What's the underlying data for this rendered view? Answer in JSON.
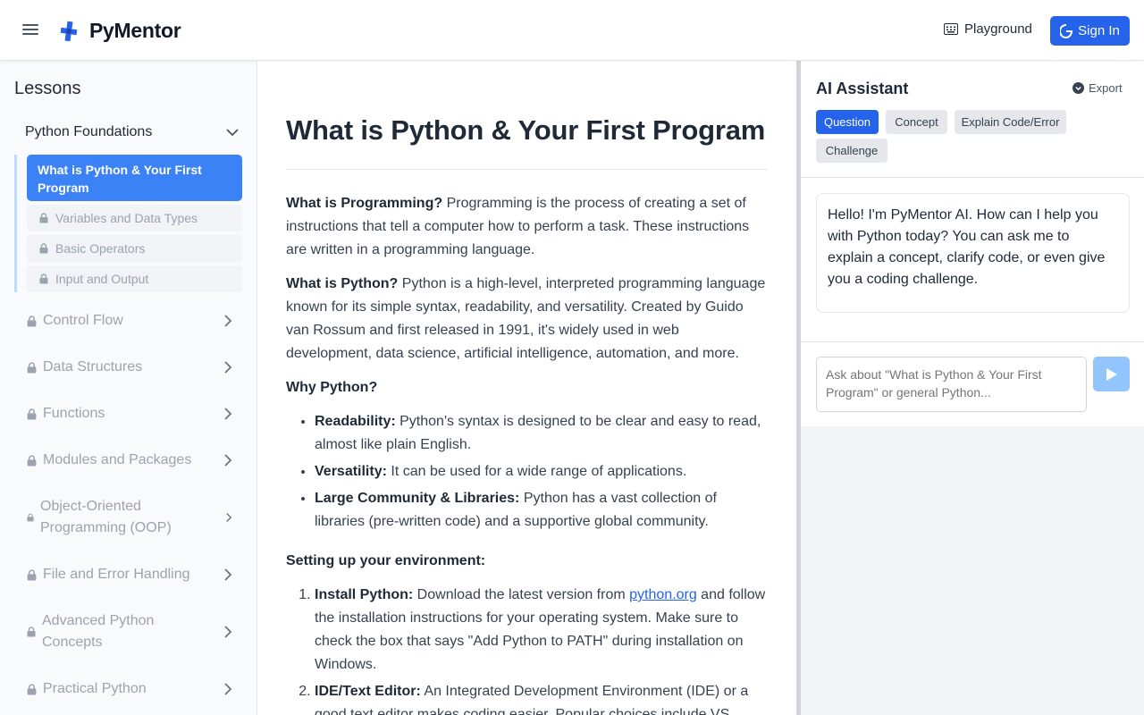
{
  "header": {
    "app_name": "PyMentor",
    "playground_label": "Playground",
    "signin_label": "Sign In"
  },
  "sidebar": {
    "title": "Lessons",
    "open_section": {
      "label": "Python Foundations",
      "items": [
        {
          "label": "What is Python & Your First Program",
          "active": true
        },
        {
          "label": "Variables and Data Types",
          "locked": true
        },
        {
          "label": "Basic Operators",
          "locked": true
        },
        {
          "label": "Input and Output",
          "locked": true
        }
      ]
    },
    "sections": [
      {
        "label": "Control Flow"
      },
      {
        "label": "Data Structures"
      },
      {
        "label": "Functions"
      },
      {
        "label": "Modules and Packages"
      },
      {
        "label": "Object-Oriented Programming (OOP)"
      },
      {
        "label": "File and Error Handling"
      },
      {
        "label": "Advanced Python Concepts"
      },
      {
        "label": "Practical Python"
      }
    ]
  },
  "lesson": {
    "title": "What is Python & Your First Program",
    "p1_bold": "What is Programming?",
    "p1_text": " Programming is the process of creating a set of instructions that tell a computer how to perform a task. These instructions are written in a programming language.",
    "p2_bold": "What is Python?",
    "p2_text": " Python is a high-level, interpreted programming language known for its simple syntax, readability, and versatility. Created by Guido van Rossum and first released in 1991, it's widely used in web development, data science, artificial intelligence, automation, and more.",
    "why_heading": "Why Python?",
    "why_items": [
      {
        "bold": "Readability:",
        "text": " Python's syntax is designed to be clear and easy to read, almost like plain English."
      },
      {
        "bold": "Versatility:",
        "text": " It can be used for a wide range of applications."
      },
      {
        "bold": "Large Community & Libraries:",
        "text": " Python has a vast collection of libraries (pre-written code) and a supportive global community."
      }
    ],
    "setup_heading": "Setting up your environment:",
    "step1_bold": "Install Python:",
    "step1_pre": " Download the latest version from ",
    "step1_link": "python.org",
    "step1_post": " and follow the installation instructions for your operating system. Make sure to check the box that says \"Add Python to PATH\" during installation on Windows.",
    "step2_bold": "IDE/Text Editor:",
    "step2_text": " An Integrated Development Environment (IDE) or a good text editor makes coding easier. Popular choices include VS"
  },
  "assistant": {
    "title": "AI Assistant",
    "export_label": "Export",
    "modes": [
      "Question",
      "Concept",
      "Explain Code/Error",
      "Challenge"
    ],
    "active_mode": "Question",
    "greeting": "Hello! I'm PyMentor AI. How can I help you with Python today? You can ask me to explain a concept, clarify code, or even give you a coding challenge.",
    "input_placeholder": "Ask about \"What is Python & Your First Program\" or general Python..."
  },
  "colors": {
    "accent": "#2563eb",
    "active_lesson": "#3b82f6",
    "send_button": "#93c5fd"
  }
}
